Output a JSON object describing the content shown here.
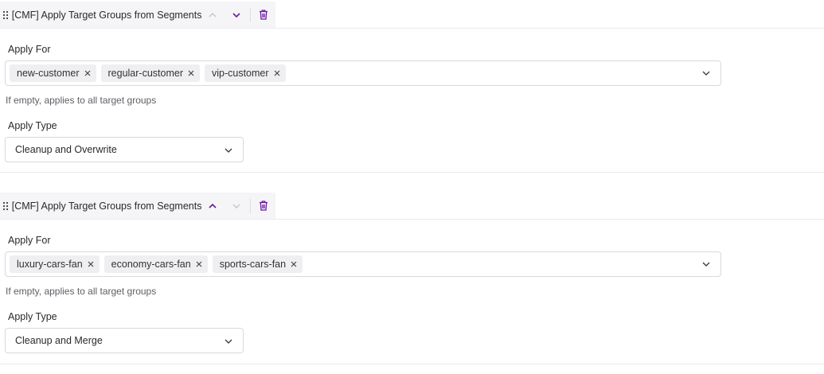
{
  "blocks": [
    {
      "title": "[CMF] Apply Target Groups from Segments",
      "move_up_enabled": false,
      "move_down_enabled": true,
      "apply_for_label": "Apply For",
      "tags": [
        "new-customer",
        "regular-customer",
        "vip-customer"
      ],
      "hint": "If empty, applies to all target groups",
      "apply_type_label": "Apply Type",
      "apply_type_value": "Cleanup and Overwrite"
    },
    {
      "title": "[CMF] Apply Target Groups from Segments",
      "move_up_enabled": true,
      "move_down_enabled": false,
      "apply_for_label": "Apply For",
      "tags": [
        "luxury-cars-fan",
        "economy-cars-fan",
        "sports-cars-fan"
      ],
      "hint": "If empty, applies to all target groups",
      "apply_type_label": "Apply Type",
      "apply_type_value": "Cleanup and Merge"
    }
  ],
  "icons": {
    "drag": "drag-handle-icon",
    "up": "chevron-up-icon",
    "down": "chevron-down-icon",
    "delete": "trash-icon",
    "remove_tag": "close-icon",
    "dropdown": "chevron-down-icon"
  },
  "colors": {
    "accent": "#6a1b9a",
    "disabled": "#c4c4cc",
    "header_bg": "#f5f5f7",
    "border": "#d9d9df",
    "tag_bg": "#efeff1",
    "hint_text": "#5e5e66"
  }
}
